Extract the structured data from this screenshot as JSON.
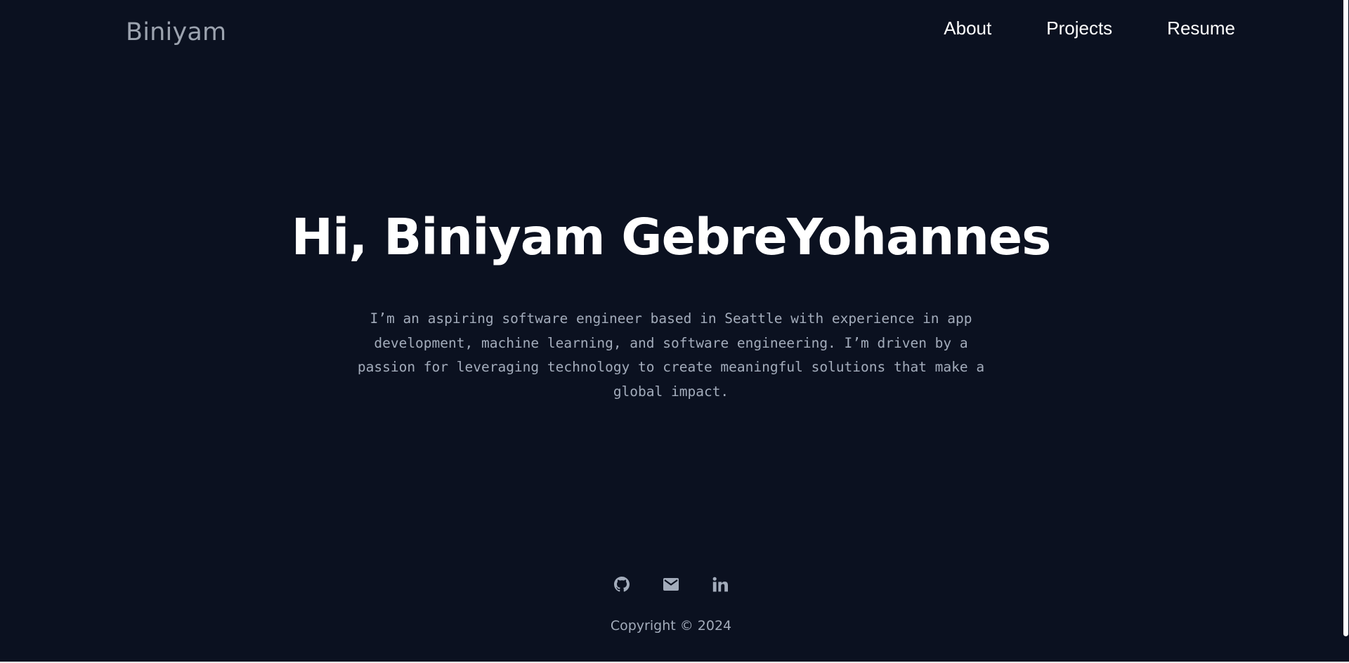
{
  "header": {
    "brand": "Biniyam",
    "nav": [
      {
        "label": "About"
      },
      {
        "label": "Projects"
      },
      {
        "label": "Resume"
      }
    ]
  },
  "hero": {
    "title": "Hi, Biniyam GebreYohannes",
    "description": "I’m an aspiring software engineer based in Seattle with experience in app development, machine learning, and software engineering. I’m driven by a passion for leveraging technology to create meaningful solutions that make a global impact."
  },
  "footer": {
    "socials": [
      {
        "icon": "github-icon"
      },
      {
        "icon": "mail-icon"
      },
      {
        "icon": "linkedin-icon"
      }
    ],
    "copyright": "Copyright © 2024"
  },
  "colors": {
    "background": "#0b1120",
    "brand": "#9ca3af",
    "text_muted": "#a3acbb",
    "heading": "#ffffff"
  }
}
